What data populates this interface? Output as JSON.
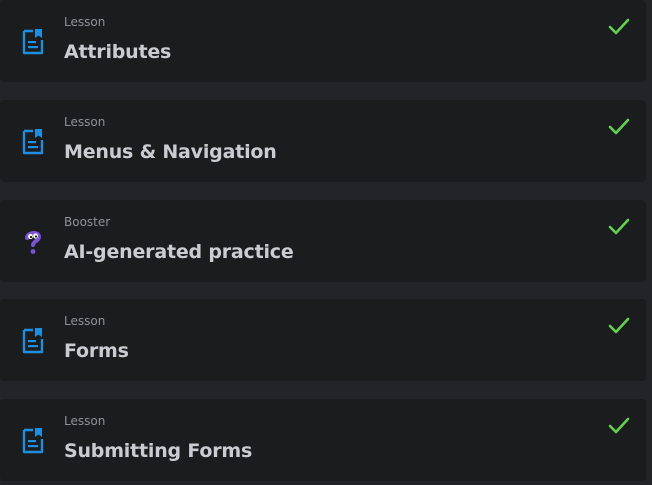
{
  "items": [
    {
      "kind": "Lesson",
      "title": "Attributes",
      "icon": "lesson-document-icon",
      "completed": true
    },
    {
      "kind": "Lesson",
      "title": "Menus & Navigation",
      "icon": "lesson-document-icon",
      "completed": true
    },
    {
      "kind": "Booster",
      "title": "AI-generated practice",
      "icon": "booster-question-icon",
      "completed": true
    },
    {
      "kind": "Lesson",
      "title": "Forms",
      "icon": "lesson-document-icon",
      "completed": true
    },
    {
      "kind": "Lesson",
      "title": "Submitting Forms",
      "icon": "lesson-document-icon",
      "completed": true
    }
  ],
  "colors": {
    "page_background": "#232427",
    "card_background": "#1b1c1e",
    "lesson_icon": "#1e8fe0",
    "booster_icon": "#7a52d6",
    "check": "#62d24e",
    "title_text": "#c9ccd1",
    "kind_text": "#8f9197"
  }
}
